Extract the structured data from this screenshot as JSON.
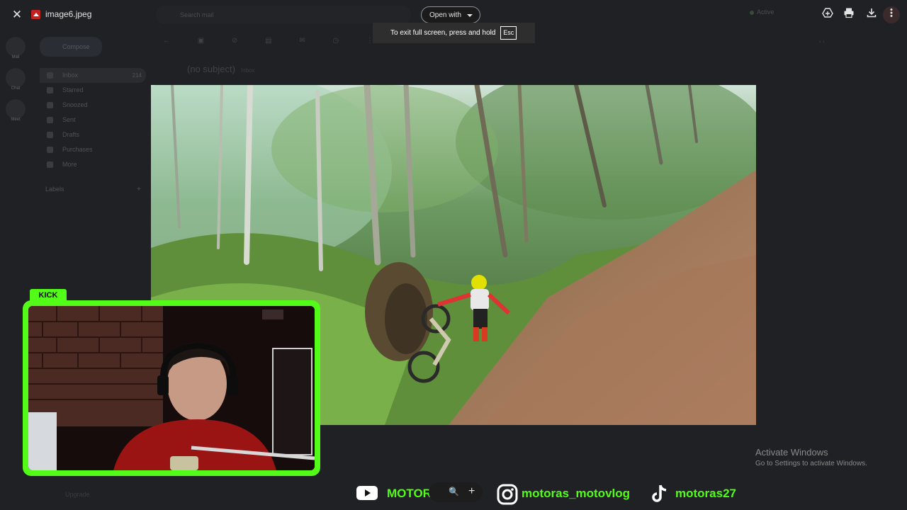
{
  "viewer": {
    "file_name": "image6.jpeg",
    "open_with_label": "Open with",
    "fullscreen_toast": "To exit full screen, press and hold",
    "fullscreen_key": "Esc",
    "toolbar_icons": [
      "add-to-drive-icon",
      "print-icon",
      "download-icon",
      "more-vert-icon"
    ]
  },
  "background": {
    "search_placeholder": "Search mail",
    "status": "Active",
    "compose": "Compose",
    "folders": [
      {
        "label": "Inbox",
        "count": "214"
      },
      {
        "label": "Starred",
        "count": ""
      },
      {
        "label": "Snoozed",
        "count": ""
      },
      {
        "label": "Sent",
        "count": ""
      },
      {
        "label": "Drafts",
        "count": ""
      },
      {
        "label": "Purchases",
        "count": ""
      },
      {
        "label": "More",
        "count": ""
      }
    ],
    "labels_heading": "Labels",
    "subject": "(no subject)",
    "subject_tag": "Inbox",
    "upgrade": "Upgrade",
    "rail": [
      "Mail",
      "Chat",
      "Meet"
    ]
  },
  "overlay": {
    "kick_badge": "KICK",
    "socials": [
      {
        "icon": "youtube-icon",
        "handle": "MOTORAS"
      },
      {
        "icon": "instagram-icon",
        "handle": "motoras_motovlog"
      },
      {
        "icon": "tiktok-icon",
        "handle": "motoras27"
      }
    ],
    "brand_color": "#53fc18"
  },
  "os_watermark": {
    "title": "Activate Windows",
    "subtitle": "Go to Settings to activate Windows."
  }
}
